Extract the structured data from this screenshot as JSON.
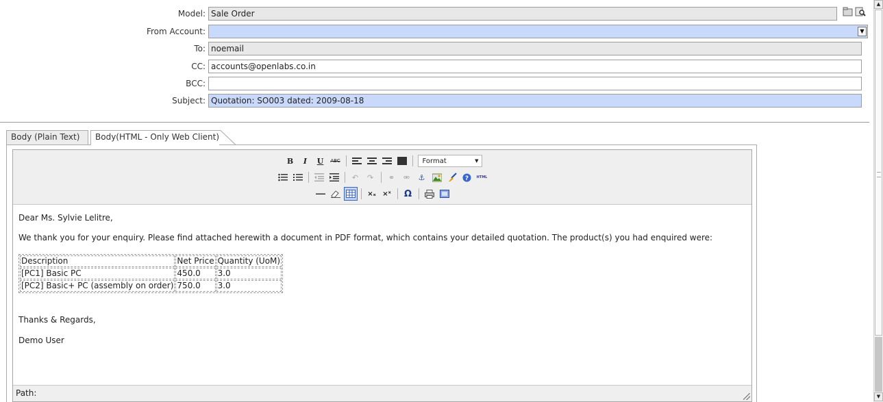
{
  "form": {
    "model": {
      "label": "Model:",
      "value": "Sale Order"
    },
    "from_account": {
      "label": "From Account:",
      "value": ""
    },
    "to": {
      "label": "To:",
      "value": "noemail"
    },
    "cc": {
      "label": "CC:",
      "value": "accounts@openlabs.co.in"
    },
    "bcc": {
      "label": "BCC:",
      "value": ""
    },
    "subject": {
      "label": "Subject:",
      "value": "Quotation: SO003 dated: 2009-08-18"
    }
  },
  "tabs": [
    {
      "label": "Body (Plain Text)",
      "active": false
    },
    {
      "label": "Body(HTML - Only Web Client)",
      "active": true
    }
  ],
  "toolbar": {
    "format_select": "Format",
    "icons": {
      "bold": "B",
      "italic": "I",
      "underline": "U",
      "strike": "ABC",
      "subscript": "×ₓ",
      "superscript": "×ˣ",
      "charmap": "Ω",
      "html": "HTML"
    }
  },
  "body": {
    "greeting": "Dear Ms. Sylvie Lelitre,",
    "intro": "We thank you for your enquiry. Please find attached herewith a document in PDF format, which contains your detailed quotation. The product(s) you had enquired were:",
    "table": {
      "headers": [
        "Description",
        "Net Price",
        "Quantity (UoM)"
      ],
      "rows": [
        [
          "[PC1] Basic PC",
          "450.0",
          "3.0"
        ],
        [
          "[PC2] Basic+ PC (assembly on order)",
          "750.0",
          "3.0"
        ]
      ]
    },
    "closing": "Thanks & Regards,",
    "signature": "Demo User"
  },
  "path_label": "Path:",
  "colors": {
    "required_field": "#c9d9fc",
    "readonly_field": "#e8e8e8",
    "toolbar_bg": "#efefef"
  }
}
